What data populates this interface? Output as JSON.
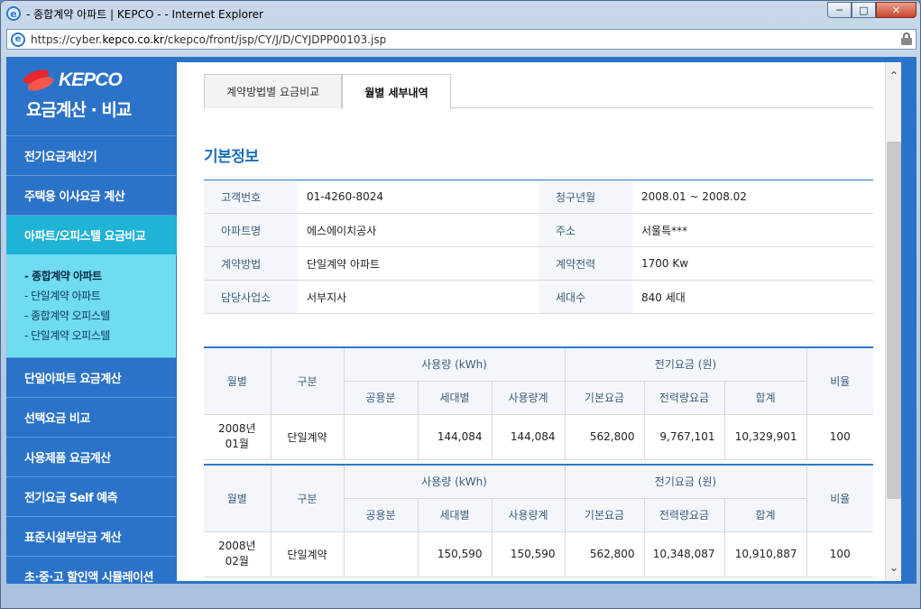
{
  "window": {
    "title": "- 종합계약 아파트 | KEPCO - - Internet Explorer",
    "url_prefix": "https://cyber.",
    "url_domain": "kepco.co.kr",
    "url_path": "/ckepco/front/jsp/CY/J/D/CYJDPP00103.jsp",
    "btn_min": "─",
    "btn_max": "□",
    "btn_close": "✕"
  },
  "sidebar": {
    "logo_text": "KEPCO",
    "app_title": "요금계산 · 비교",
    "items": [
      {
        "label": "전기요금계산기"
      },
      {
        "label": "주택용 이사요금 계산"
      },
      {
        "label": "아파트/오피스텔 요금비교"
      },
      {
        "label": "단일아파트 요금계산"
      },
      {
        "label": "선택요금 비교"
      },
      {
        "label": "사용제품 요금계산"
      },
      {
        "label": "전기요금 Self 예측"
      },
      {
        "label": "표준시설부담금 계산"
      },
      {
        "label": "초·중·고 할인액 시뮬레이션"
      }
    ],
    "subitems": [
      {
        "label": "- 종합계약 아파트"
      },
      {
        "label": "- 단일계약 아파트"
      },
      {
        "label": "- 종합계약 오피스텔"
      },
      {
        "label": "- 단일계약 오피스텔"
      }
    ]
  },
  "tabs": [
    {
      "label": "계약방법별 요금비교"
    },
    {
      "label": "월별 세부내역"
    }
  ],
  "section_title": "기본정보",
  "info": {
    "rows": [
      {
        "l1": "고객번호",
        "v1": "01-4260-8024",
        "l2": "청구년월",
        "v2": "2008.01 ~ 2008.02"
      },
      {
        "l1": "아파트명",
        "v1": "에스에이치공사",
        "l2": "주소",
        "v2": "서울특***"
      },
      {
        "l1": "계약방법",
        "v1": "단일계약 아파트",
        "l2": "계약전력",
        "v2": "1700 Kw"
      },
      {
        "l1": "담당사업소",
        "v1": "서부지사",
        "l2": "세대수",
        "v2": "840 세대"
      }
    ]
  },
  "bill_headers": {
    "month": "월별",
    "type": "구분",
    "usage": "사용량 (kWh)",
    "charge": "전기요금 (원)",
    "ratio": "비율",
    "common": "공용분",
    "household": "세대별",
    "usage_total": "사용량계",
    "basic": "기본요금",
    "energy": "전력량요금",
    "sum": "합계"
  },
  "bills": [
    {
      "year": "2008년",
      "month": "01월",
      "type": "단일계약",
      "common": "",
      "household": "144,084",
      "usage_total": "144,084",
      "basic": "562,800",
      "energy": "9,767,101",
      "sum": "10,329,901",
      "ratio": "100"
    },
    {
      "year": "2008년",
      "month": "02월",
      "type": "단일계약",
      "common": "",
      "household": "150,590",
      "usage_total": "150,590",
      "basic": "562,800",
      "energy": "10,348,087",
      "sum": "10,910,887",
      "ratio": "100"
    }
  ],
  "scrollbar": {
    "up": "⌃",
    "down": "⌄"
  }
}
